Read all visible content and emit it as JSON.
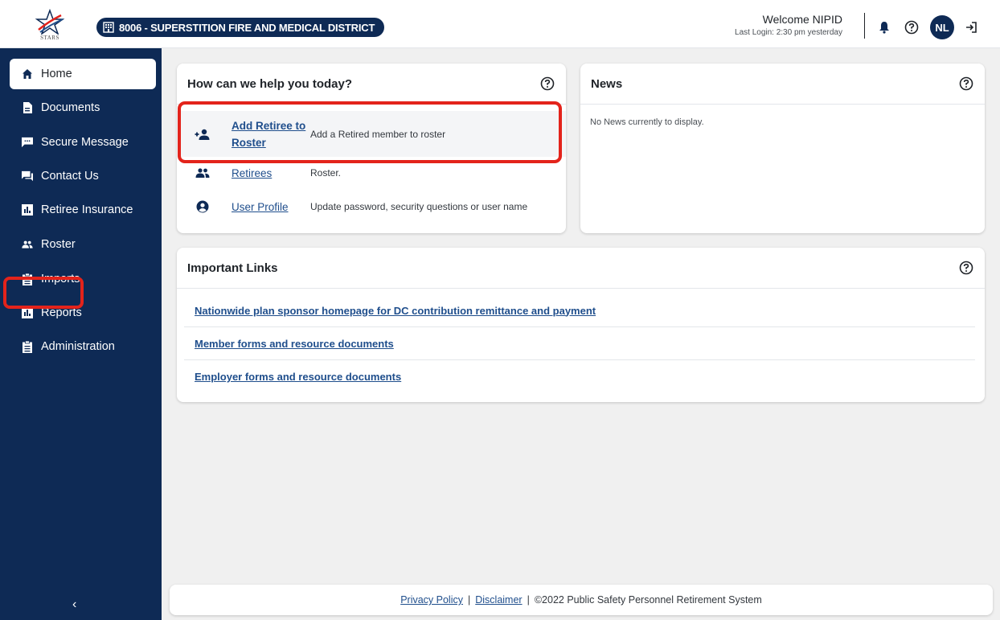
{
  "header": {
    "logo_text": "STARS",
    "agency": "8006 - SUPERSTITION FIRE AND MEDICAL DISTRICT",
    "welcome": "Welcome NIPID",
    "last_login": "Last Login: 2:30 pm yesterday",
    "avatar_initials": "NL",
    "icons": [
      "bell-icon",
      "help-icon",
      "logout-icon"
    ]
  },
  "sidebar": {
    "items": [
      {
        "label": "Home",
        "icon": "home-icon",
        "active": true
      },
      {
        "label": "Documents",
        "icon": "document-icon"
      },
      {
        "label": "Secure Message",
        "icon": "message-icon"
      },
      {
        "label": "Contact Us",
        "icon": "chat-icon"
      },
      {
        "label": "Retiree Insurance",
        "icon": "bar-chart-icon"
      },
      {
        "label": "Roster",
        "icon": "people-icon"
      },
      {
        "label": "Imports",
        "icon": "clipboard-icon"
      },
      {
        "label": "Reports",
        "icon": "bar-chart-icon"
      },
      {
        "label": "Administration",
        "icon": "clipboard-icon"
      }
    ],
    "collapse_label": "‹"
  },
  "help_card": {
    "title": "How can we help you today?",
    "rows": [
      {
        "link": "Add Retiree to Roster",
        "link_line1": "Add Retiree to",
        "link_line2": "Roster",
        "desc": "Add a Retired member to roster",
        "icon": "add-person-icon"
      },
      {
        "link": "Retirees",
        "desc": "Roster.",
        "icon": "people-icon"
      },
      {
        "link": "User Profile",
        "desc": "Update password, security questions or user name",
        "icon": "user-circle-icon"
      }
    ]
  },
  "news_card": {
    "title": "News",
    "empty": "No News currently to display."
  },
  "links_card": {
    "title": "Important Links",
    "links": [
      "Nationwide plan sponsor homepage for DC contribution remittance and payment",
      "Member forms and resource documents",
      "Employer forms and resource documents"
    ]
  },
  "footer": {
    "privacy": "Privacy Policy",
    "disclaimer": "Disclaimer",
    "copyright": "©2022 Public Safety Personnel Retirement System",
    "sep": "|"
  },
  "colors": {
    "navy": "#0e2a55",
    "link": "#1f4e8c",
    "highlight": "#e3231b",
    "background": "#f0f0f0"
  }
}
